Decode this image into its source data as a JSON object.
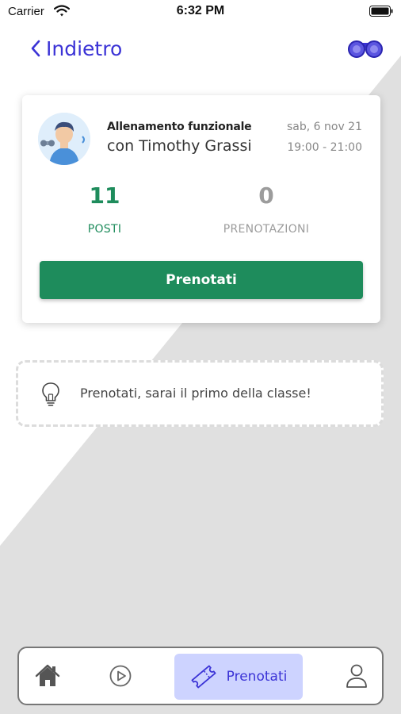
{
  "status_bar": {
    "carrier": "Carrier",
    "time": "6:32 PM",
    "icons": [
      "wifi-icon",
      "battery-icon"
    ]
  },
  "header": {
    "back_label": "Indietro",
    "right_icon": "binoculars-icon"
  },
  "class_card": {
    "title": "Allenamento funzionale",
    "instructor": "con Timothy Grassi",
    "date": "sab, 6 nov 21",
    "time": "19:00 - 21:00",
    "spots_value": "11",
    "spots_label": "POSTI",
    "bookings_value": "0",
    "bookings_label": "PRENOTAZIONI",
    "book_button": "Prenotati"
  },
  "tip": {
    "icon": "lightbulb-icon",
    "text": "Prenotati, sarai il primo della classe!"
  },
  "tab_bar": {
    "tabs": [
      {
        "icon": "home-icon",
        "label": "",
        "active": false
      },
      {
        "icon": "play-icon",
        "label": "",
        "active": false
      },
      {
        "icon": "ticket-icon",
        "label": "Prenotati",
        "active": true
      },
      {
        "icon": "user-icon",
        "label": "",
        "active": false
      }
    ]
  },
  "colors": {
    "accent": "#3b33d6",
    "green": "#1e8c5c",
    "active_tab_bg": "#cdd3ff",
    "background_diagonal": "#e0e0e0"
  }
}
